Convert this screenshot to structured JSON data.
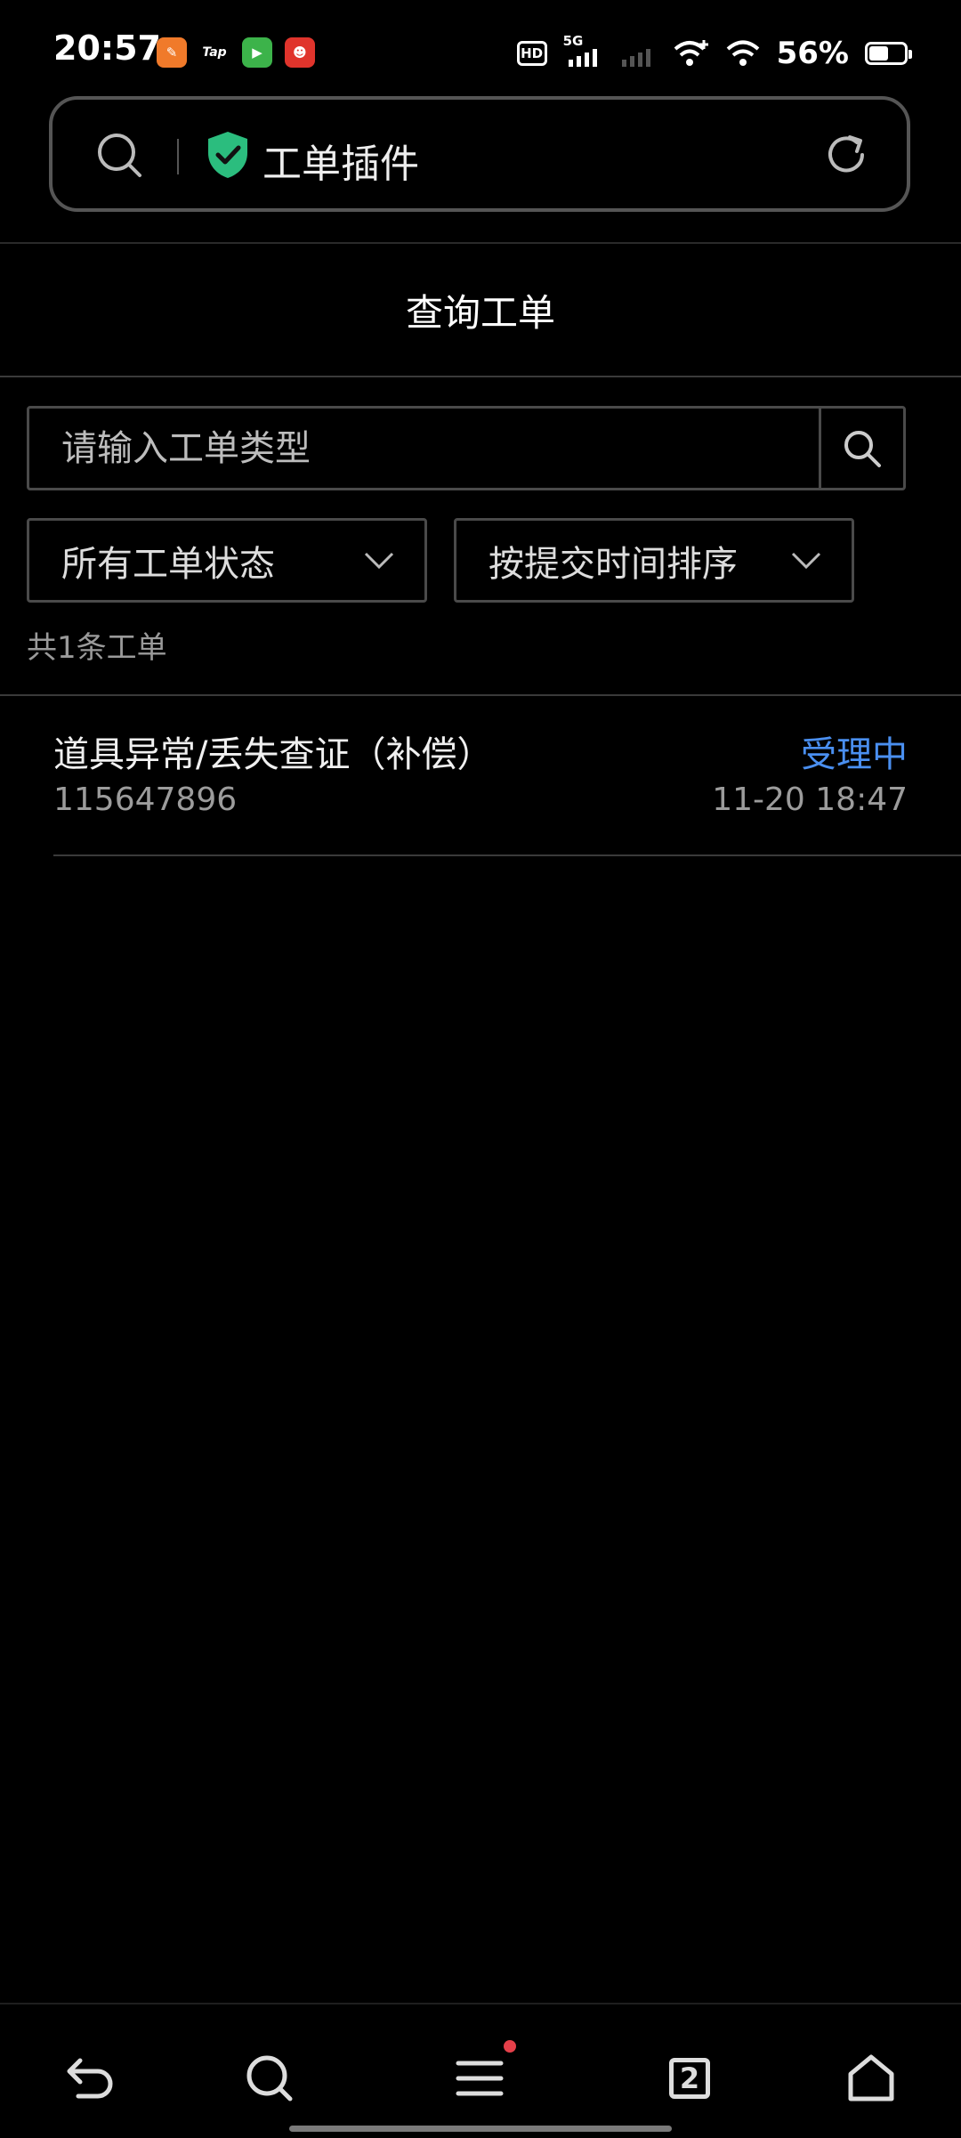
{
  "status_bar": {
    "time": "20:57",
    "app_icons": [
      {
        "name": "app-icon-orange",
        "glyph": "✎",
        "color": "#f07a2a"
      },
      {
        "name": "tap-icon",
        "glyph": "Tap",
        "color": "#000000"
      },
      {
        "name": "video-app-icon",
        "glyph": "▶",
        "color": "#3cb34a"
      },
      {
        "name": "red-app-icon",
        "glyph": "☻",
        "color": "#e0342c"
      }
    ],
    "hd_label": "HD",
    "network": "5G",
    "battery_percent": "56%",
    "battery_level": 0.56
  },
  "address_bar": {
    "title": "工单插件"
  },
  "page": {
    "heading": "查询工单"
  },
  "search": {
    "placeholder": "请输入工单类型"
  },
  "filters": {
    "status_selected": "所有工单状态",
    "sort_selected": "按提交时间排序"
  },
  "count_text": "共1条工单",
  "tickets": [
    {
      "title": "道具异常/丢失查证（补偿）",
      "status": "受理中",
      "id": "115647896",
      "time": "11-20 18:47"
    }
  ],
  "bottom_nav": {
    "tab_count": "2"
  },
  "colors": {
    "background": "#000000",
    "accent_status": "#4a8ff0",
    "shield": "#2bbd7e",
    "badge": "#e5404a"
  }
}
